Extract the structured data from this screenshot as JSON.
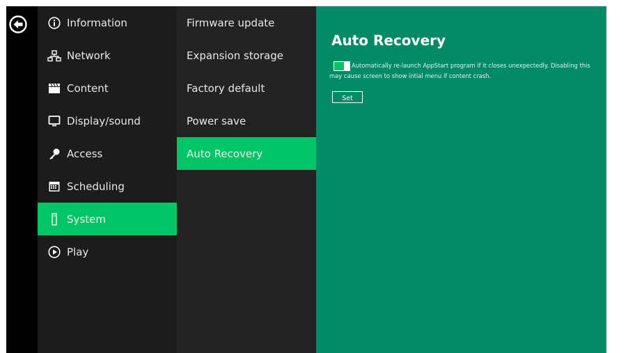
{
  "nav": {
    "back_icon": "back-arrow-icon",
    "items": [
      {
        "label": "Information",
        "icon": "info-icon"
      },
      {
        "label": "Network",
        "icon": "network-icon"
      },
      {
        "label": "Content",
        "icon": "clapperboard-icon"
      },
      {
        "label": "Display/sound",
        "icon": "monitor-icon"
      },
      {
        "label": "Access",
        "icon": "key-icon"
      },
      {
        "label": "Scheduling",
        "icon": "calendar-icon"
      },
      {
        "label": "System",
        "icon": "usb-drive-icon",
        "active": true
      },
      {
        "label": "Play",
        "icon": "play-circle-icon"
      }
    ]
  },
  "submenu": {
    "items": [
      {
        "label": "Firmware update"
      },
      {
        "label": "Expansion storage"
      },
      {
        "label": "Factory default"
      },
      {
        "label": "Power save"
      },
      {
        "label": "Auto Recovery",
        "active": true
      }
    ]
  },
  "content": {
    "title": "Auto Recovery",
    "toggle_on": true,
    "description": "Automatically re-launch AppStart program if it closes unexpectedly. Disabling this may cause screen to show intial menu if content crash.",
    "set_label": "Set"
  },
  "colors": {
    "accent": "#00c566",
    "content_bg": "#008b66",
    "nav_bg": "#1c1c1c",
    "submenu_bg": "#232323"
  }
}
